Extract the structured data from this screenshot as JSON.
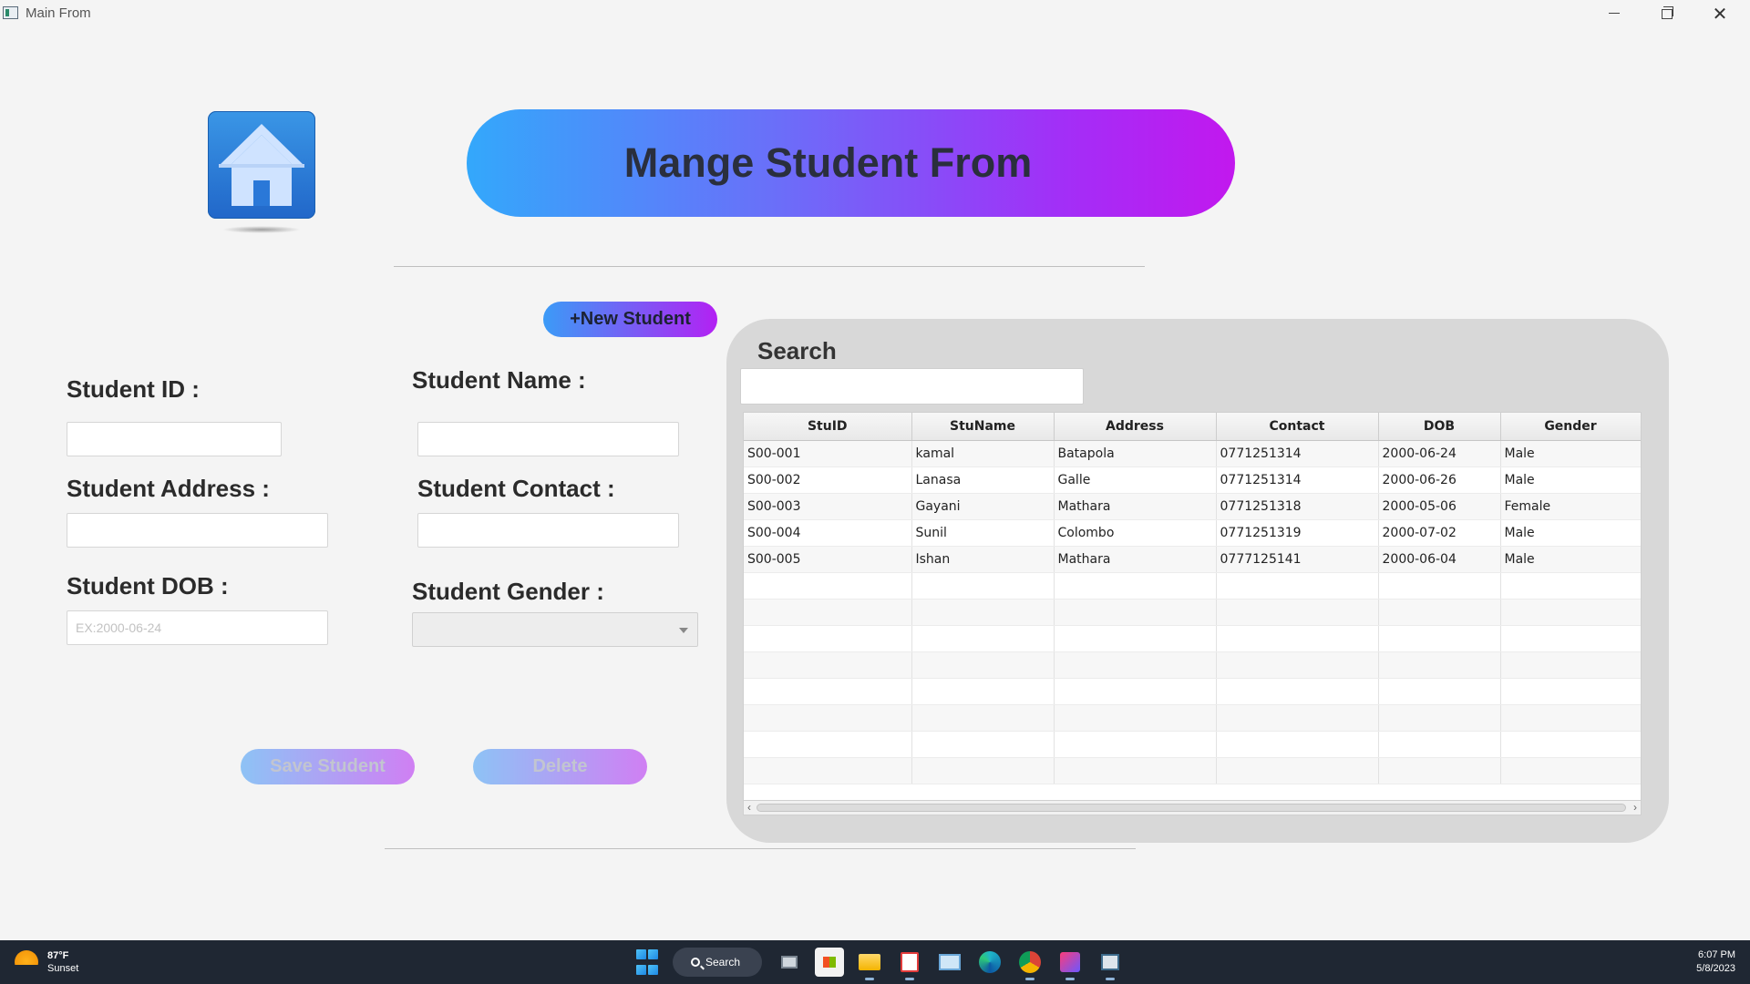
{
  "window": {
    "title": "Main From",
    "close_glyph": "✕"
  },
  "header": {
    "title": "Mange Student From"
  },
  "actions": {
    "new_student_label": "+New Student",
    "save_label": "Save Student",
    "delete_label": "Delete"
  },
  "form": {
    "student_id_label": "Student ID :",
    "student_name_label": "Student Name :",
    "student_address_label": "Student Address :",
    "student_contact_label": "Student Contact :",
    "student_dob_label": "Student DOB :",
    "student_gender_label": "Student Gender :",
    "dob_placeholder": "EX:2000-06-24",
    "student_id_value": "",
    "student_name_value": "",
    "student_address_value": "",
    "student_contact_value": "",
    "student_dob_value": "",
    "student_gender_value": ""
  },
  "search": {
    "label": "Search",
    "value": ""
  },
  "table": {
    "columns": [
      "StuID",
      "StuName",
      "Address",
      "Contact",
      "DOB",
      "Gender"
    ],
    "rows": [
      [
        "S00-001",
        "kamal",
        "Batapola",
        "0771251314",
        "2000-06-24",
        "Male"
      ],
      [
        "S00-002",
        "Lanasa",
        "Galle",
        "0771251314",
        "2000-06-26",
        "Male"
      ],
      [
        "S00-003",
        "Gayani",
        "Mathara",
        "0771251318",
        "2000-05-06",
        "Female"
      ],
      [
        "S00-004",
        "Sunil",
        "Colombo",
        "0771251319",
        "2000-07-02",
        "Male"
      ],
      [
        "S00-005",
        "Ishan",
        "Mathara",
        "0777125141",
        "2000-06-04",
        "Male"
      ]
    ],
    "empty_rows": 8
  },
  "taskbar": {
    "temperature": "87°F",
    "weather_text": "Sunset",
    "search_label": "Search",
    "time": "6:07 PM",
    "date": "5/8/2023"
  },
  "colors": {
    "banner_gradient_start": "#33a8fb",
    "banner_gradient_end": "#c218ee",
    "button_gradient_start": "#3b9bf7",
    "button_gradient_end": "#b321f3",
    "panel_background": "#d8d8d8",
    "taskbar_background": "#1f2733"
  },
  "icons": {
    "home": "home-icon",
    "app": "java-app-icon",
    "weather": "sunset-icon"
  }
}
